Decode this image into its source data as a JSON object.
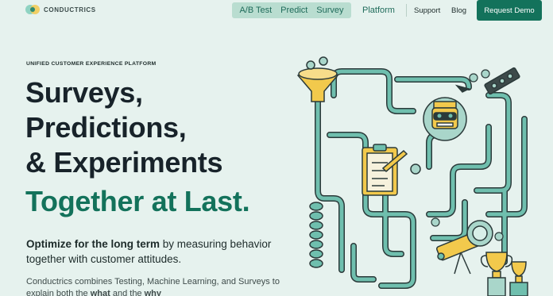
{
  "brand": {
    "name": "CONDUCTRICS"
  },
  "nav": {
    "pill_items": [
      "A/B Test",
      "Predict",
      "Survey"
    ],
    "platform": "Platform",
    "support": "Support",
    "blog": "Blog",
    "cta": "Request Demo"
  },
  "hero": {
    "eyebrow": "UNIFIED CUSTOMER EXPERIENCE PLATFORM",
    "line1": "Surveys,",
    "line2": "Predictions,",
    "line3": "& Experiments",
    "line4": "Together at Last.",
    "lead_bold": "Optimize for the long term",
    "lead_rest": " by measuring behavior together with customer attitudes.",
    "sub_text": "Conductrics combines Testing, Machine Learning, and Surveys to explain both the ",
    "sub_what": "what",
    "sub_and": " and the ",
    "sub_why": "why"
  },
  "colors": {
    "background": "#e6f2ee",
    "accent": "#13725b",
    "pipe": "#6fbfae",
    "pill": "#b9ddd0"
  },
  "illustration": {
    "icons": [
      "funnel-icon",
      "robot-icon",
      "clipboard-icon",
      "telescope-icon",
      "trophy-icon",
      "pipe-maze"
    ]
  }
}
